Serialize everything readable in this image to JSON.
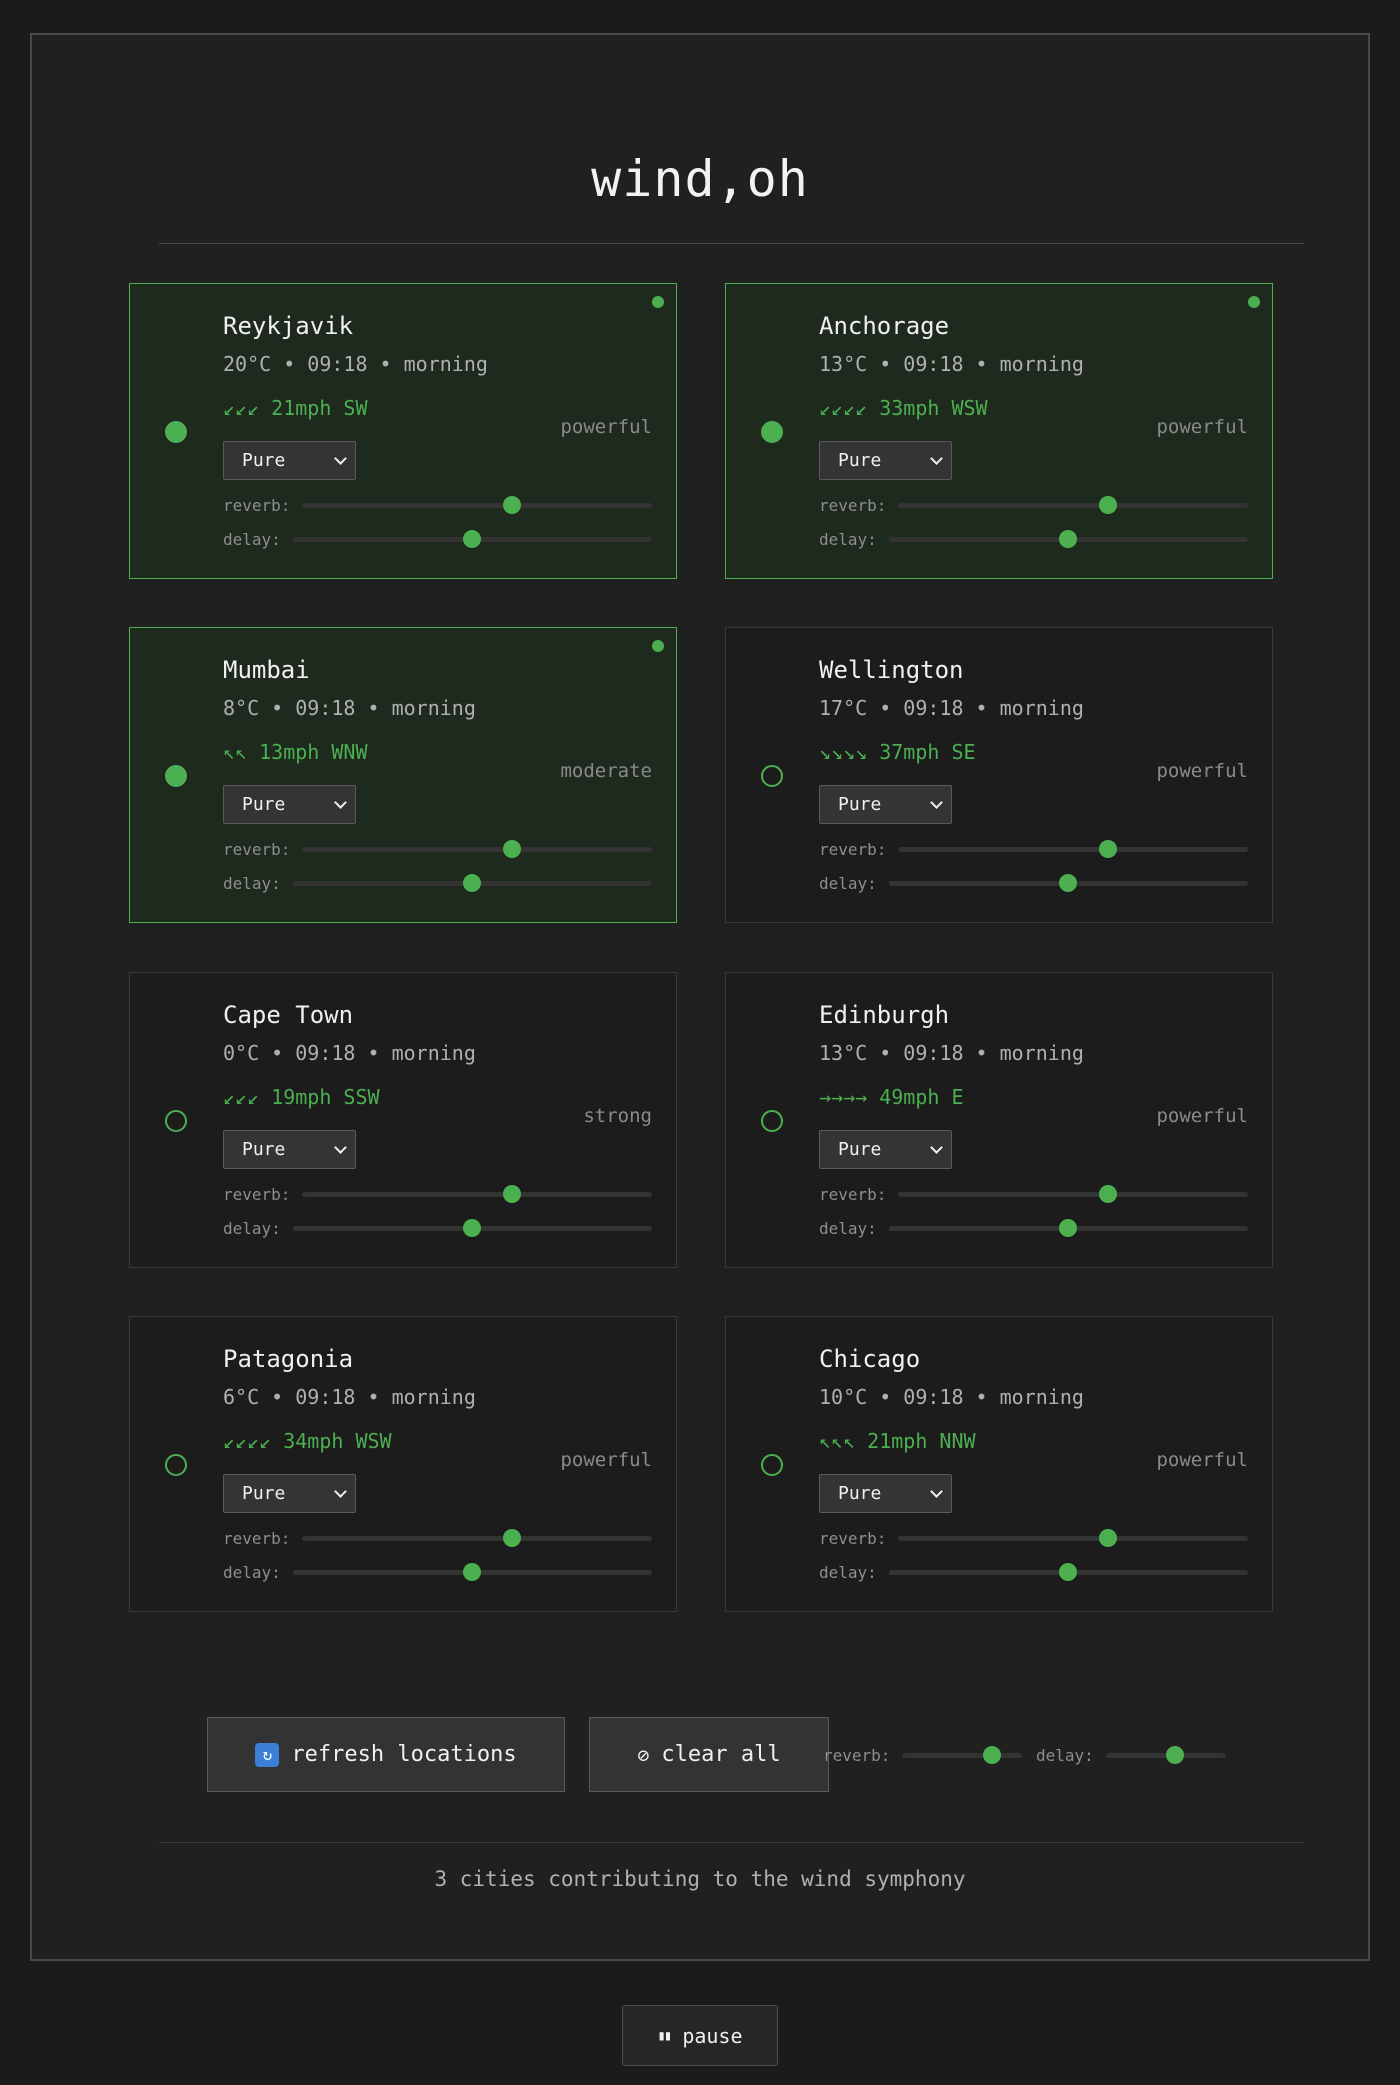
{
  "app": {
    "title": "wind,oh"
  },
  "cities": [
    {
      "name": "Reykjavik",
      "meta": "20°C • 09:18 • morning",
      "arrows": "↙↙↙",
      "wind": "21mph SW",
      "strength": "powerful",
      "preset": "Pure",
      "reverb_label": "reverb:",
      "delay_label": "delay:",
      "reverb": 0.6,
      "delay": 0.5,
      "active": true
    },
    {
      "name": "Anchorage",
      "meta": "13°C • 09:18 • morning",
      "arrows": "↙↙↙↙",
      "wind": "33mph WSW",
      "strength": "powerful",
      "preset": "Pure",
      "reverb_label": "reverb:",
      "delay_label": "delay:",
      "reverb": 0.6,
      "delay": 0.5,
      "active": true
    },
    {
      "name": "Mumbai",
      "meta": "8°C • 09:18 • morning",
      "arrows": "↖↖",
      "wind": "13mph WNW",
      "strength": "moderate",
      "preset": "Pure",
      "reverb_label": "reverb:",
      "delay_label": "delay:",
      "reverb": 0.6,
      "delay": 0.5,
      "active": true
    },
    {
      "name": "Wellington",
      "meta": "17°C • 09:18 • morning",
      "arrows": "↘↘↘↘",
      "wind": "37mph SE",
      "strength": "powerful",
      "preset": "Pure",
      "reverb_label": "reverb:",
      "delay_label": "delay:",
      "reverb": 0.6,
      "delay": 0.5,
      "active": false
    },
    {
      "name": "Cape Town",
      "meta": "0°C • 09:18 • morning",
      "arrows": "↙↙↙",
      "wind": "19mph SSW",
      "strength": "strong",
      "preset": "Pure",
      "reverb_label": "reverb:",
      "delay_label": "delay:",
      "reverb": 0.6,
      "delay": 0.5,
      "active": false
    },
    {
      "name": "Edinburgh",
      "meta": "13°C • 09:18 • morning",
      "arrows": "→→→→",
      "wind": "49mph E",
      "strength": "powerful",
      "preset": "Pure",
      "reverb_label": "reverb:",
      "delay_label": "delay:",
      "reverb": 0.6,
      "delay": 0.5,
      "active": false
    },
    {
      "name": "Patagonia",
      "meta": "6°C • 09:18 • morning",
      "arrows": "↙↙↙↙",
      "wind": "34mph WSW",
      "strength": "powerful",
      "preset": "Pure",
      "reverb_label": "reverb:",
      "delay_label": "delay:",
      "reverb": 0.6,
      "delay": 0.5,
      "active": false
    },
    {
      "name": "Chicago",
      "meta": "10°C • 09:18 • morning",
      "arrows": "↖↖↖",
      "wind": "21mph NNW",
      "strength": "powerful",
      "preset": "Pure",
      "reverb_label": "reverb:",
      "delay_label": "delay:",
      "reverb": 0.6,
      "delay": 0.5,
      "active": false
    }
  ],
  "controls": {
    "refresh_label": "refresh locations",
    "refresh_icon": "🔄",
    "clear_label": "clear all",
    "clear_icon": "⊘",
    "global_reverb_label": "reverb:",
    "global_delay_label": "delay:",
    "global_reverb": 0.75,
    "global_delay": 0.58
  },
  "status": {
    "text": "3 cities contributing to the wind symphony"
  },
  "pause": {
    "label": "pause",
    "icon": "⏸"
  },
  "colors": {
    "accent": "#4caf50",
    "background": "#1b1b1b",
    "panel": "#202020",
    "active_card": "#1e2a1e"
  }
}
